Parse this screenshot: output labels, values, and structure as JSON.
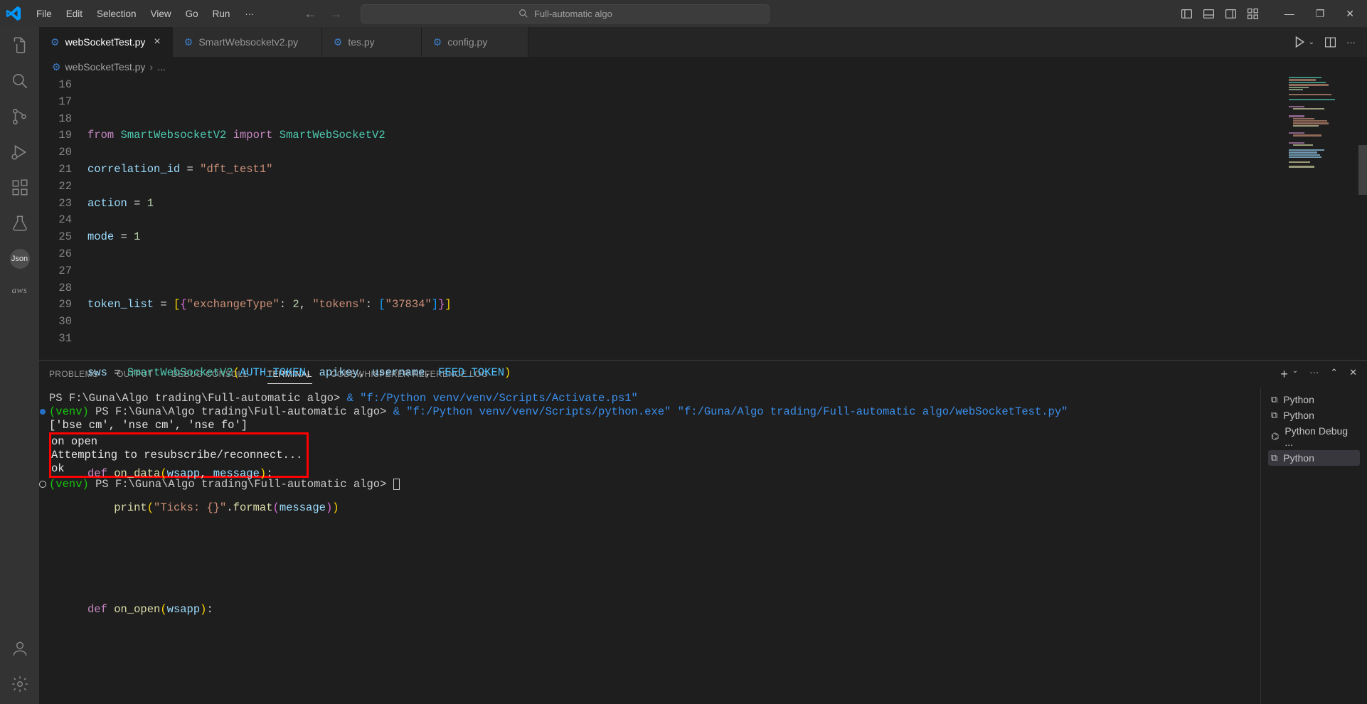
{
  "workspace_name": "Full-automatic algo",
  "menus": [
    "File",
    "Edit",
    "Selection",
    "View",
    "Go",
    "Run"
  ],
  "tabs": [
    {
      "label": "webSocketTest.py",
      "active": true,
      "dirty": false
    },
    {
      "label": "SmartWebsocketv2.py",
      "active": false,
      "dirty": false
    },
    {
      "label": "tes.py",
      "active": false,
      "dirty": false
    },
    {
      "label": "config.py",
      "active": false,
      "dirty": false
    }
  ],
  "breadcrumb": {
    "file": "webSocketTest.py",
    "more": "..."
  },
  "first_line_number": 16,
  "panel_tabs": [
    "PROBLEMS",
    "OUTPUT",
    "DEBUG CONSOLE",
    "TERMINAL",
    "CODEWHISPERER REFERENCE LOG"
  ],
  "panel_active": "TERMINAL",
  "terminal_sidebar": [
    {
      "label": "Python",
      "icon": "shell"
    },
    {
      "label": "Python",
      "icon": "shell"
    },
    {
      "label": "Python Debug ...",
      "icon": "bug"
    },
    {
      "label": "Python",
      "icon": "shell",
      "active": true
    }
  ],
  "terminal": {
    "prompt1_prefix": "PS F:\\Guna\\Algo trading\\Full-automatic algo> ",
    "cmd1": "& \"f:/Python venv/venv/Scripts/Activate.ps1\"",
    "venv": "(venv)",
    "prompt2_prefix": " PS F:\\Guna\\Algo trading\\Full-automatic algo> ",
    "cmd2a": "& \"f:/Python venv/venv/Scripts/python.exe\" ",
    "cmd2b": "\"f:/Guna/Algo trading/Full-automatic algo/webSocketTest.py\"",
    "out_list": "['bse cm', 'nse cm', 'nse fo']",
    "out1": "on open",
    "out2": "Attempting to resubscribe/reconnect...",
    "out3": "ok",
    "prompt3_prefix": " PS F:\\Guna\\Algo trading\\Full-automatic algo> "
  },
  "code": {
    "from": "from",
    "import": "import",
    "mod": "SmartWebsocketV2",
    "cls": "SmartWebSocketV2",
    "corr": "correlation_id",
    "eq": " = ",
    "corr_val": "\"dft_test1\"",
    "action": "action",
    "one": "1",
    "mode": "mode",
    "tokenlist": "token_list",
    "tl_val_open": " = [{",
    "ex": "\"exchangeType\"",
    "two": "2",
    "tk": "\"tokens\"",
    "tkval": "\"37834\"",
    "tl_val_close": "}]",
    "sws": "sws",
    "auth": "AUTH_TOKEN",
    "api": "apikey",
    "user": "username",
    "feed": "FEED_TOKEN",
    "def": "def",
    "ondata": "on_data",
    "wsapp": "wsapp",
    "message": "message",
    "print": "print",
    "ticks": "\"Ticks: {}\"",
    "format": "format",
    "onopen": "on_open"
  }
}
